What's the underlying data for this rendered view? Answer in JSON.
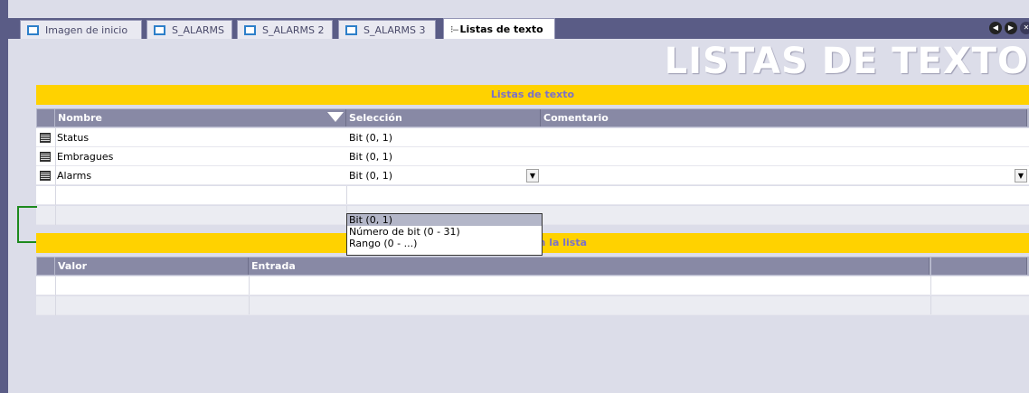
{
  "tabs": [
    {
      "label": "Imagen de inicio",
      "active": false
    },
    {
      "label": "S_ALARMS",
      "active": false
    },
    {
      "label": "S_ALARMS 2",
      "active": false
    },
    {
      "label": "S_ALARMS 3",
      "active": false
    },
    {
      "label": "Listas de texto",
      "active": true
    }
  ],
  "page_title": "LISTAS DE TEXTO",
  "text_lists": {
    "header": "Listas de texto",
    "columns": {
      "name": "Nombre",
      "selection": "Selección",
      "comment": "Comentario"
    },
    "rows": [
      {
        "name": "Status",
        "selection": "Bit (0, 1)",
        "comment": ""
      },
      {
        "name": "Embragues",
        "selection": "Bit (0, 1)",
        "comment": ""
      },
      {
        "name": "Alarms",
        "selection": "Bit (0, 1)",
        "comment": ""
      }
    ]
  },
  "selection_dropdown": {
    "options": [
      "Bit (0, 1)",
      "Número de bit (0 - 31)",
      "Rango (0 - ...)"
    ],
    "selected": "Bit (0, 1)"
  },
  "list_entries": {
    "header": "Entradas en la lista",
    "columns": {
      "value": "Valor",
      "entry": "Entrada"
    }
  },
  "colors": {
    "section_header_bg": "#ffd200",
    "section_header_text": "#7a70c9",
    "column_header_bg": "#8889a5",
    "frame": "#5a5c86",
    "workspace": "#dcdde9",
    "tab_icon": "#2d7fc9",
    "bracket": "#1e8a1e"
  }
}
